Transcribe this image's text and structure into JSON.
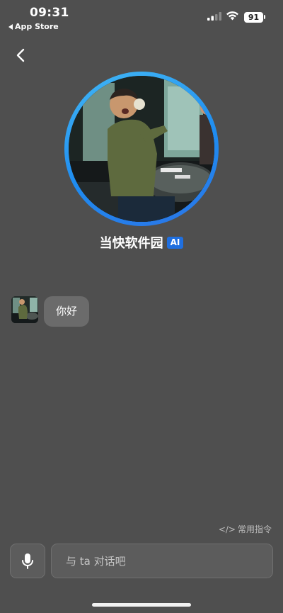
{
  "status_bar": {
    "time": "09:31",
    "back_app_label": "App Store",
    "battery": "91"
  },
  "contact": {
    "name": "当快软件园",
    "badge": "AI"
  },
  "messages": [
    {
      "from": "contact",
      "text": "你好"
    }
  ],
  "quick_commands": {
    "icon_text": "</>",
    "label": "常用指令"
  },
  "input": {
    "placeholder": "与 ta 对话吧",
    "value": ""
  },
  "icons": {
    "back": "chevron-left-icon",
    "mic": "microphone-icon",
    "signal": "cellular-signal-icon",
    "wifi": "wifi-icon",
    "battery": "battery-icon"
  },
  "colors": {
    "background": "#4f4f4f",
    "avatar_ring": "#1f8cf0",
    "ai_badge": "#1f6fe0",
    "bubble": "#6b6b6b",
    "input_bg": "#5c5c5c"
  }
}
